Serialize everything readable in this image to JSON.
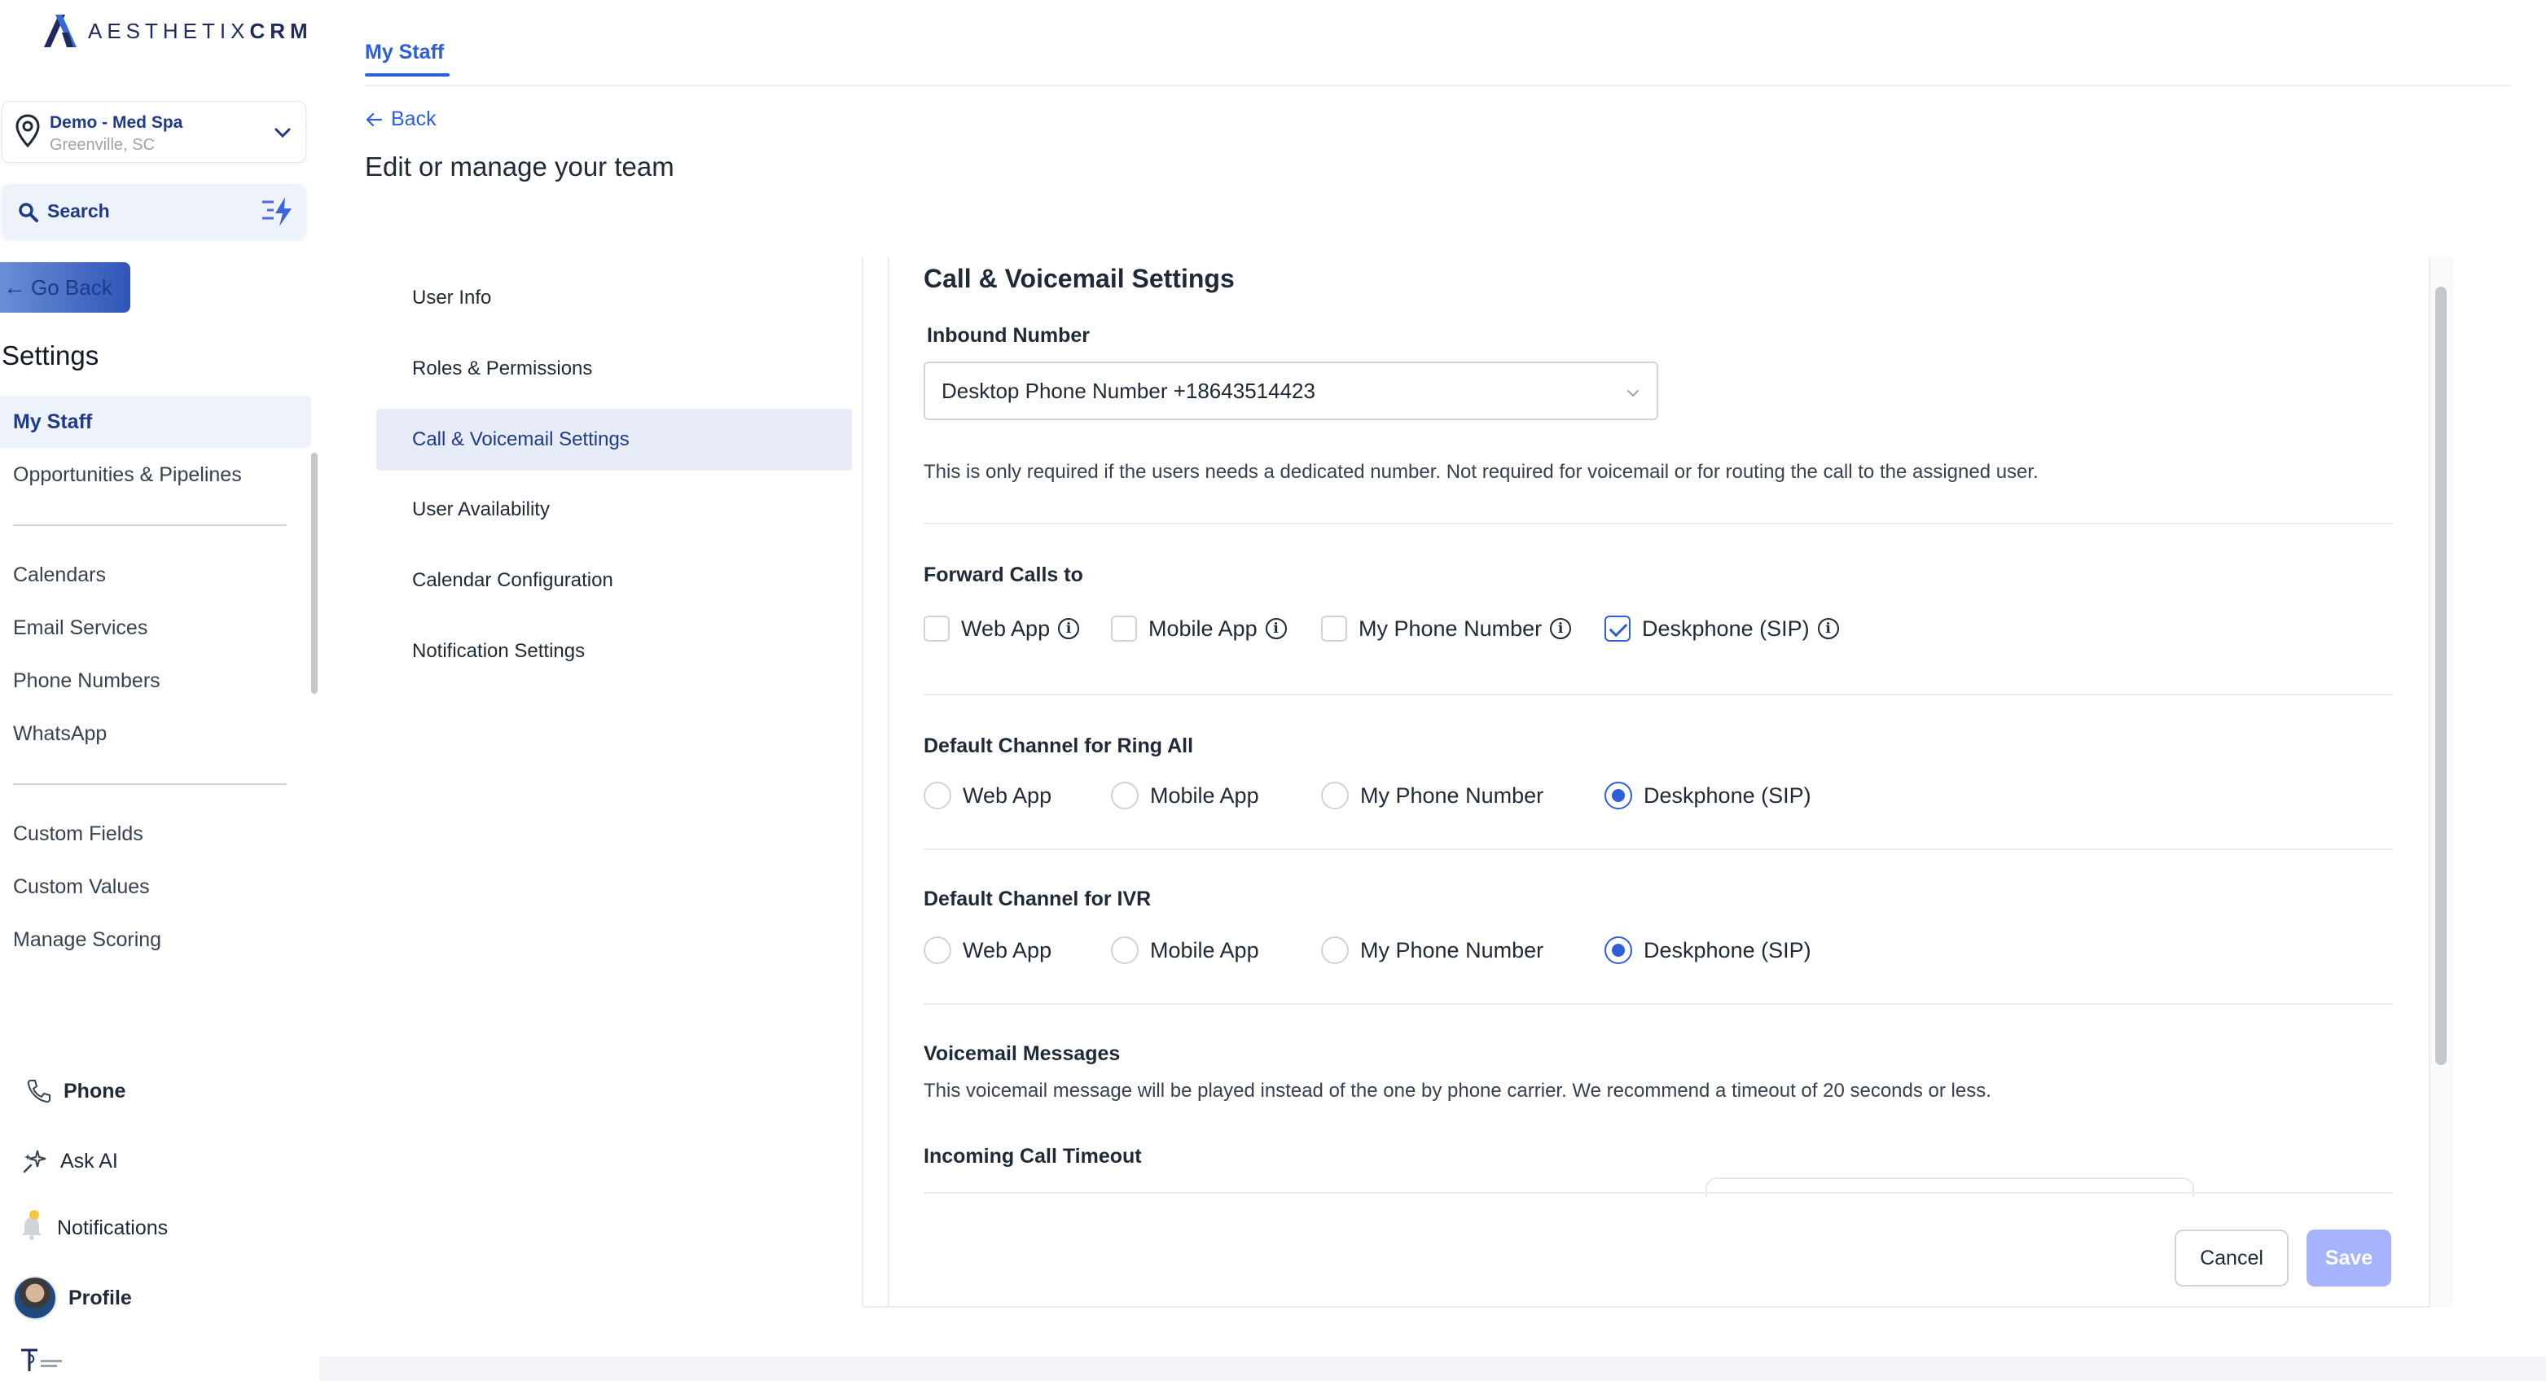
{
  "brand": {
    "logo_text": "AESTHETIX",
    "logo_suffix": "CRM",
    "accent": "#2f5fd8"
  },
  "location": {
    "name": "Demo - Med Spa",
    "city": "Greenville, SC"
  },
  "search": {
    "label": "Search"
  },
  "sidebar": {
    "go_back": "Go Back",
    "title": "Settings",
    "items": [
      {
        "label": "My Staff"
      },
      {
        "label": "Opportunities & Pipelines"
      },
      {
        "label": "Calendars"
      },
      {
        "label": "Email Services"
      },
      {
        "label": "Phone Numbers"
      },
      {
        "label": "WhatsApp"
      },
      {
        "label": "Custom Fields"
      },
      {
        "label": "Custom Values"
      },
      {
        "label": "Manage Scoring"
      }
    ],
    "bottom": {
      "phone": "Phone",
      "ask_ai": "Ask AI",
      "notifications": "Notifications",
      "profile": "Profile"
    }
  },
  "header": {
    "tab": "My Staff",
    "back": "Back",
    "title": "Edit or manage your team"
  },
  "subnav": [
    {
      "label": "User Info"
    },
    {
      "label": "Roles & Permissions"
    },
    {
      "label": "Call & Voicemail Settings"
    },
    {
      "label": "User Availability"
    },
    {
      "label": "Calendar Configuration"
    },
    {
      "label": "Notification Settings"
    }
  ],
  "panel": {
    "title": "Call & Voicemail Settings",
    "inbound": {
      "label": "Inbound Number",
      "value": "Desktop Phone Number +18643514423",
      "help": "This is only required if the users needs a dedicated number. Not required for voicemail or for routing the call to the assigned user."
    },
    "forward": {
      "label": "Forward Calls to",
      "options": [
        {
          "label": "Web App",
          "checked": false
        },
        {
          "label": "Mobile App",
          "checked": false
        },
        {
          "label": "My Phone Number",
          "checked": false
        },
        {
          "label": "Deskphone (SIP)",
          "checked": true
        }
      ]
    },
    "ring_all": {
      "label": "Default Channel for Ring All",
      "options": [
        "Web App",
        "Mobile App",
        "My Phone Number",
        "Deskphone (SIP)"
      ],
      "selected": "Deskphone (SIP)"
    },
    "ivr": {
      "label": "Default Channel for IVR",
      "options": [
        "Web App",
        "Mobile App",
        "My Phone Number",
        "Deskphone (SIP)"
      ],
      "selected": "Deskphone (SIP)"
    },
    "voicemail": {
      "label": "Voicemail Messages",
      "help": "This voicemail message will be played instead of the one by phone carrier. We recommend a timeout of 20 seconds or less."
    },
    "timeout": {
      "label": "Incoming Call Timeout"
    },
    "buttons": {
      "cancel": "Cancel",
      "save": "Save"
    }
  }
}
